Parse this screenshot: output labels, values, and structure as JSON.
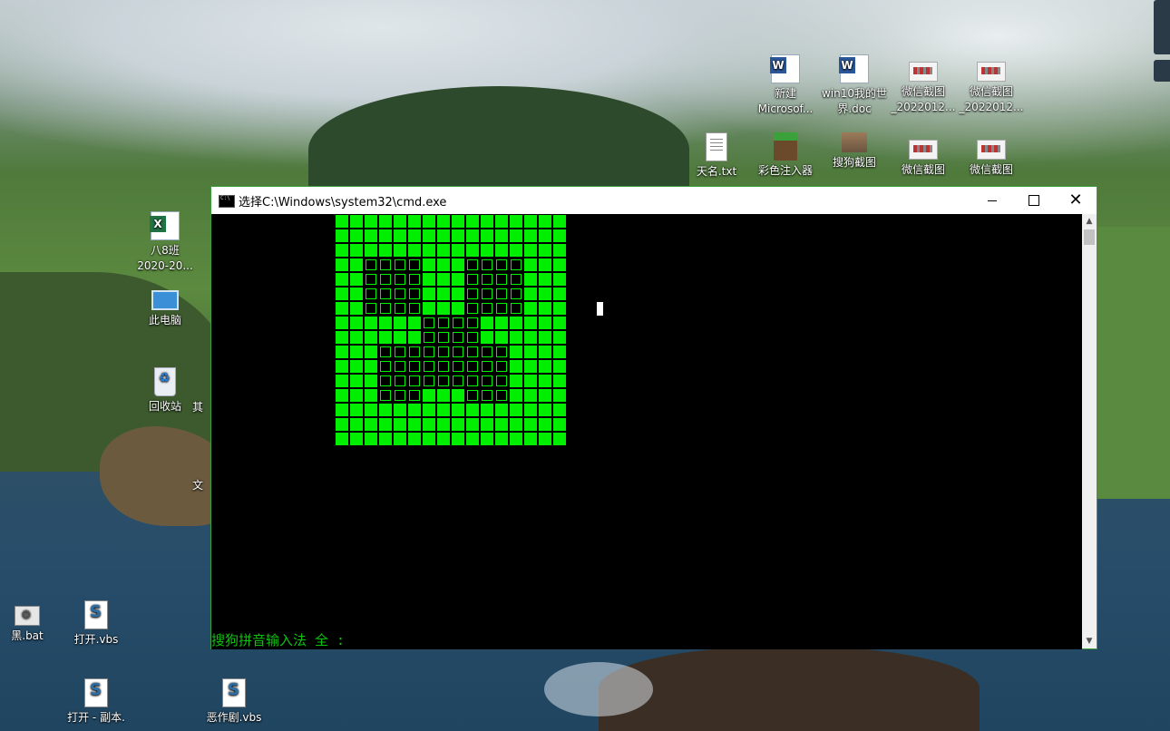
{
  "desktop": {
    "icons": [
      {
        "id": "word1",
        "label": "新建\nMicrosof...",
        "kind": "word-doc-icon"
      },
      {
        "id": "word2",
        "label": "win10我的世\n界.doc",
        "kind": "word-doc-icon"
      },
      {
        "id": "img1",
        "label": "微信截图\n_2022012...",
        "kind": "image-file-icon"
      },
      {
        "id": "img2",
        "label": "微信截图\n_2022012...",
        "kind": "image-file-icon"
      },
      {
        "id": "txt",
        "label": "天名.txt",
        "kind": "text-file-icon"
      },
      {
        "id": "mc",
        "label": "彩色注入器",
        "kind": "minecraft-icon"
      },
      {
        "id": "sogou",
        "label": "搜狗截图",
        "kind": "sogou-screenshot-icon"
      },
      {
        "id": "img3",
        "label": "微信截图",
        "kind": "image-file-icon"
      },
      {
        "id": "img4",
        "label": "微信截图",
        "kind": "image-file-icon"
      },
      {
        "id": "excel",
        "label": "八8班\n2020-20...",
        "kind": "excel-file-icon"
      },
      {
        "id": "pc",
        "label": "此电脑",
        "kind": "computer-icon"
      },
      {
        "id": "bin",
        "label": "回收站",
        "kind": "recycle-bin-icon"
      },
      {
        "id": "bat",
        "label": "黑.bat",
        "kind": "batch-file-icon"
      },
      {
        "id": "vbs1",
        "label": "打开.vbs",
        "kind": "vbs-file-icon"
      },
      {
        "id": "vbs2",
        "label": "打开 - 副本.",
        "kind": "vbs-file-icon"
      },
      {
        "id": "vbs3",
        "label": "恶作剧.vbs",
        "kind": "vbs-file-icon"
      }
    ],
    "partial_labels": {
      "a": "其",
      "b": "文"
    }
  },
  "cmd_window": {
    "title": "选择C:\\Windows\\system32\\cmd.exe",
    "ime_status": "搜狗拼音输入法 全 :",
    "accent_color": "#00ee00",
    "pixel_art_rows": [
      "1111111111111111",
      "1111111111111111",
      "1111111111111111",
      "1100001110000111",
      "1100001110000111",
      "1100001110000111",
      "1100001110000111",
      "1111110000111111",
      "1111110000111111",
      "1110000000001111",
      "1110000000001111",
      "1110000000001111",
      "1110001110001111",
      "1111111111111111",
      "1111111111111111",
      "1111111111111111"
    ]
  }
}
